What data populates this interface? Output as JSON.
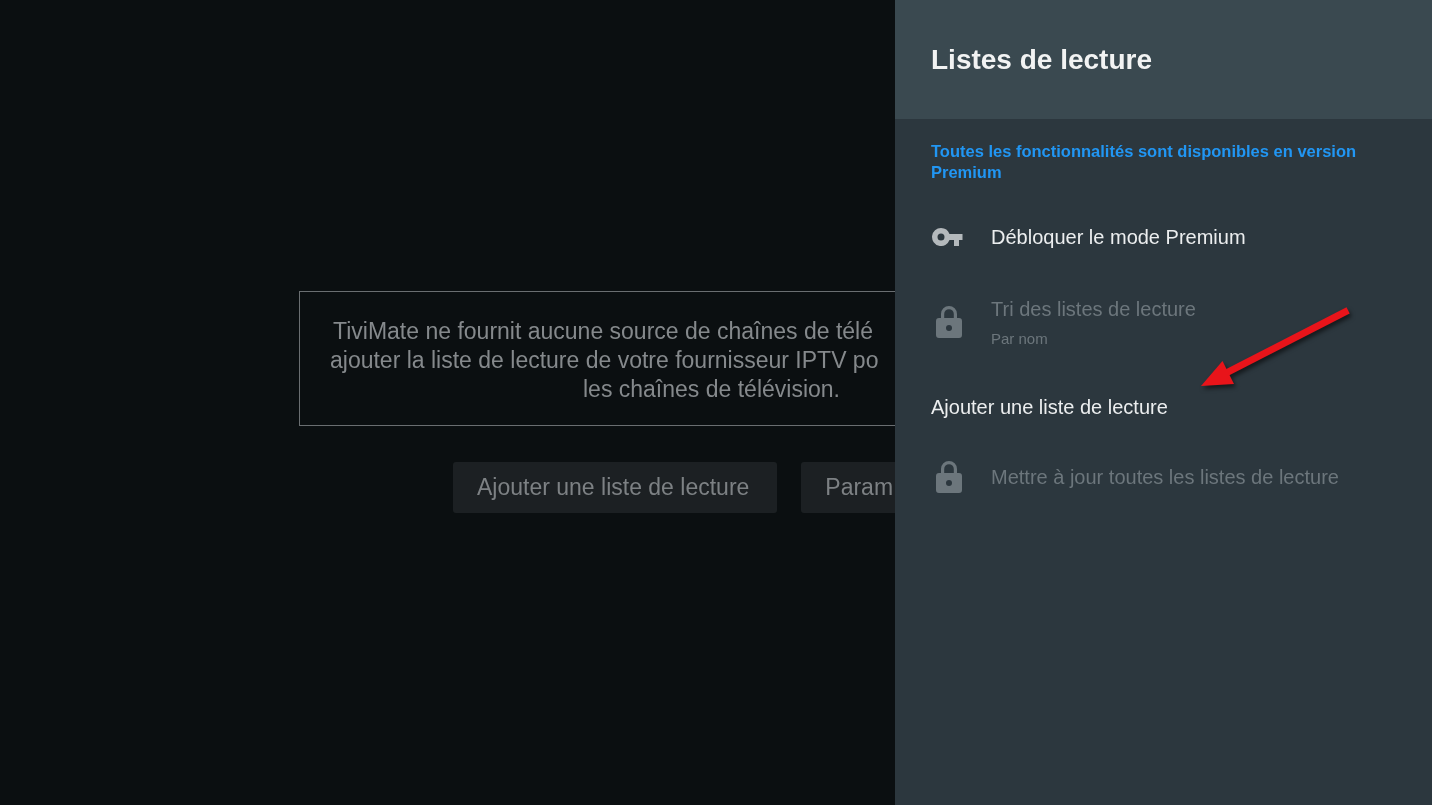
{
  "background_screen": {
    "message": [
      "TiviMate ne fournit aucune source de chaînes de télé",
      "ajouter la liste de lecture de votre fournisseur IPTV po",
      "les chaînes de télévision."
    ],
    "buttons": [
      {
        "label": "Ajouter une liste de lecture"
      },
      {
        "label": "Param"
      }
    ]
  },
  "panel": {
    "title": "Listes de lecture",
    "premium_notice": "Toutes les fonctionnalités sont disponibles en version Premium",
    "items": [
      {
        "kind": "key",
        "label": "Débloquer le mode Premium",
        "disabled": false
      },
      {
        "kind": "lock",
        "label": "Tri des listes de lecture",
        "value": "Par nom",
        "disabled": true
      },
      {
        "kind": "plain",
        "label": "Ajouter une liste de lecture",
        "disabled": false
      },
      {
        "kind": "lock",
        "label": "Mettre à jour toutes les listes de lecture",
        "disabled": true
      }
    ]
  },
  "annotation": {
    "kind": "arrow"
  }
}
